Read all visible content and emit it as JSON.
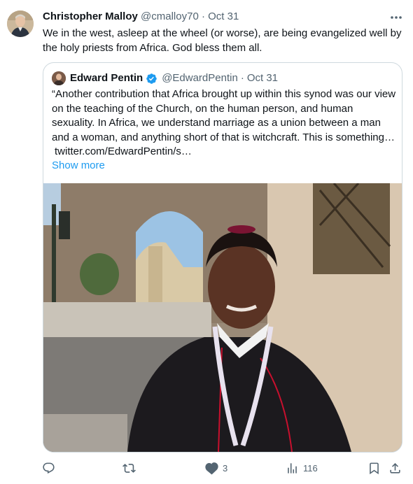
{
  "tweet": {
    "author_name": "Christopher Malloy",
    "handle": "@cmalloy70",
    "separator": "·",
    "date": "Oct 31",
    "text": "We in the west, asleep at the wheel (or worse), are being evangelized well by the holy priests from Africa. God bless them all."
  },
  "quote": {
    "author_name": "Edward Pentin",
    "verified": true,
    "handle": "@EdwardPentin",
    "separator": "·",
    "date": "Oct 31",
    "text": "“Another contribution that Africa brought up within this synod was our view on the teaching of the Church, on the human person, and human sexuality. In Africa, we understand marriage as a union between a man and a woman, and anything short of that is witchcraft. This is something…",
    "link": "twitter.com/EdwardPentin/s…",
    "show_more": "Show more"
  },
  "actions": {
    "reply_count": "",
    "retweet_count": "",
    "like_count": "3",
    "views_count": "116"
  },
  "colors": {
    "accent": "#1d9bf0",
    "muted": "#536471",
    "border": "#cfd9de",
    "text": "#0f1419"
  },
  "icons": [
    "more-icon",
    "verified-badge-icon",
    "reply-icon",
    "retweet-icon",
    "like-icon",
    "views-icon",
    "bookmark-icon",
    "share-icon"
  ]
}
